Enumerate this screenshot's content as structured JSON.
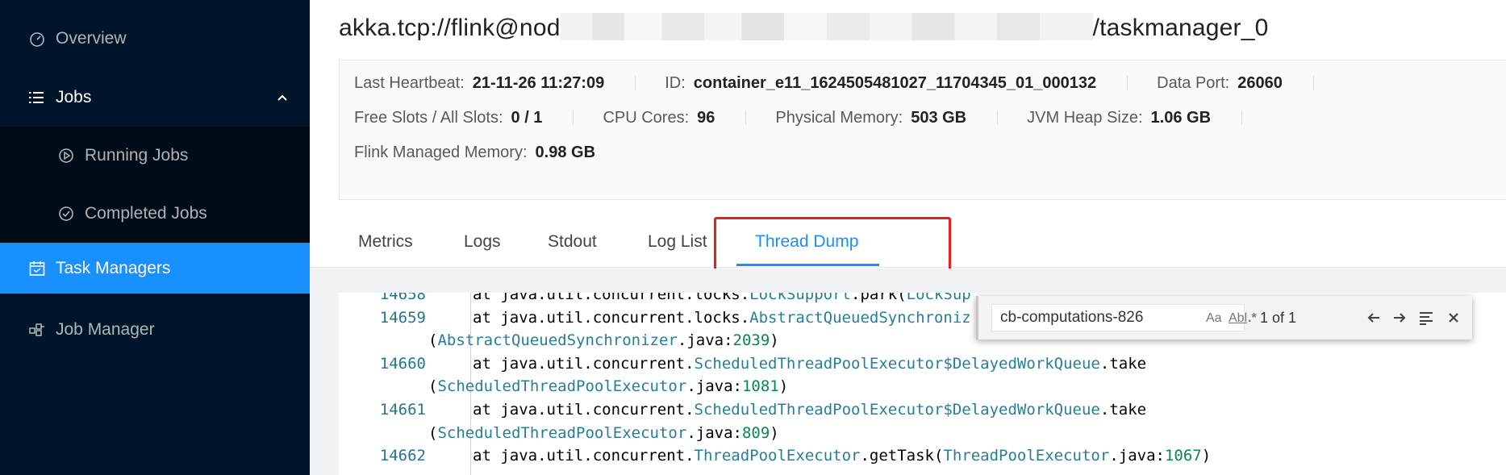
{
  "sidebar": {
    "items": [
      {
        "label": "Overview",
        "icon": "dashboard-icon"
      },
      {
        "label": "Jobs",
        "icon": "list-icon"
      },
      {
        "label": "Running Jobs",
        "icon": "play-circle-icon"
      },
      {
        "label": "Completed Jobs",
        "icon": "check-circle-icon"
      },
      {
        "label": "Task Managers",
        "icon": "schedule-icon"
      },
      {
        "label": "Job Manager",
        "icon": "cluster-icon"
      }
    ]
  },
  "header": {
    "title_prefix": "akka.tcp://flink@nod",
    "title_suffix": "/taskmanager_0"
  },
  "details": {
    "last_heartbeat": {
      "label": "Last Heartbeat:",
      "value": "21-11-26 11:27:09"
    },
    "id": {
      "label": "ID:",
      "value": "container_e11_1624505481027_11704345_01_000132"
    },
    "data_port": {
      "label": "Data Port:",
      "value": "26060"
    },
    "free_slots": {
      "label": "Free Slots / All Slots:",
      "value": "0 / 1"
    },
    "cpu_cores": {
      "label": "CPU Cores:",
      "value": "96"
    },
    "physical_memory": {
      "label": "Physical Memory:",
      "value": "503 GB"
    },
    "jvm_heap": {
      "label": "JVM Heap Size:",
      "value": "1.06 GB"
    },
    "flink_managed_memory": {
      "label": "Flink Managed Memory:",
      "value": "0.98 GB"
    }
  },
  "tabs": [
    "Metrics",
    "Logs",
    "Stdout",
    "Log List",
    "Thread Dump"
  ],
  "active_tab": "Thread Dump",
  "code": {
    "lines": [
      {
        "n": "14658",
        "parts": [
          "at java.util.concurrent.locks.",
          "LockSupport",
          ".park(",
          "LockSup"
        ]
      },
      {
        "n": "14659",
        "parts": [
          "at java.util.concurrent.locks.",
          "AbstractQueuedSynchroniz"
        ]
      },
      {
        "n": "",
        "parts": [
          "(",
          "AbstractQueuedSynchronizer",
          ".java:",
          "2039",
          ")"
        ]
      },
      {
        "n": "14660",
        "parts": [
          "at java.util.concurrent.",
          "ScheduledThreadPoolExecutor$DelayedWorkQueue",
          ".take"
        ]
      },
      {
        "n": "",
        "parts": [
          "(",
          "ScheduledThreadPoolExecutor",
          ".java:",
          "1081",
          ")"
        ]
      },
      {
        "n": "14661",
        "parts": [
          "at java.util.concurrent.",
          "ScheduledThreadPoolExecutor$DelayedWorkQueue",
          ".take"
        ]
      },
      {
        "n": "",
        "parts": [
          "(",
          "ScheduledThreadPoolExecutor",
          ".java:",
          "809",
          ")"
        ]
      },
      {
        "n": "14662",
        "parts": [
          "at java.util.concurrent.",
          "ThreadPoolExecutor",
          ".getTask(",
          "ThreadPoolExecutor",
          ".java:",
          "1067",
          ")"
        ]
      }
    ]
  },
  "find": {
    "query": "cb-computations-826",
    "match_case": "Aa",
    "whole_word": "Abl",
    "regex": ".*",
    "matches": "1 of 1"
  },
  "colors": {
    "sidebar_bg": "#001529",
    "accent": "#1890ff",
    "highlight_box": "#e2231a"
  }
}
